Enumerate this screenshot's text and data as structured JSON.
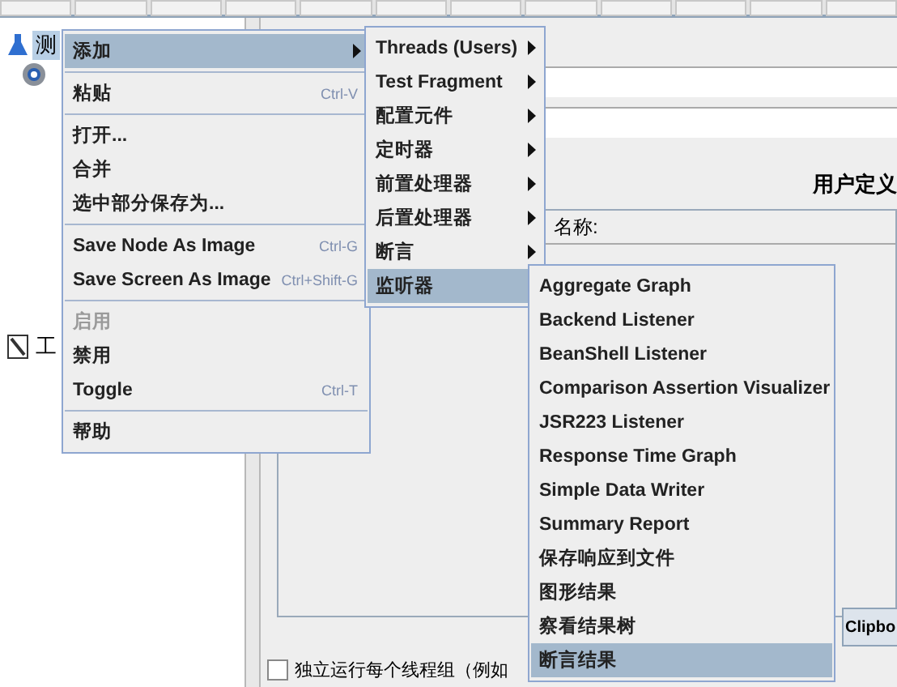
{
  "tree": {
    "items": [
      {
        "label": "测",
        "selected": true,
        "kind": "plan"
      },
      {
        "selected": false,
        "kind": "gear"
      },
      {
        "label": "工",
        "selected": false,
        "kind": "bench"
      }
    ]
  },
  "editor": {
    "table_title": "用户定义",
    "table_header": "名称:",
    "clipboard_button": "Clipbo",
    "checkbox": {
      "label": "独立运行每个线程组（例如",
      "checked": false
    }
  },
  "context_menu": {
    "items": [
      {
        "kind": "item",
        "label": "添加",
        "submenu": true,
        "selected": true,
        "disabled": false
      },
      {
        "kind": "separator"
      },
      {
        "kind": "item",
        "label": "粘贴",
        "shortcut": "Ctrl-V",
        "submenu": false,
        "selected": false,
        "disabled": false
      },
      {
        "kind": "separator"
      },
      {
        "kind": "item",
        "label": "打开...",
        "submenu": false,
        "selected": false,
        "disabled": false
      },
      {
        "kind": "item",
        "label": "合并",
        "submenu": false,
        "selected": false,
        "disabled": false
      },
      {
        "kind": "item",
        "label": "选中部分保存为...",
        "submenu": false,
        "selected": false,
        "disabled": false
      },
      {
        "kind": "separator"
      },
      {
        "kind": "item",
        "label": "Save Node As Image",
        "shortcut": "Ctrl-G",
        "submenu": false,
        "selected": false,
        "disabled": false
      },
      {
        "kind": "item",
        "label": "Save Screen As Image",
        "shortcut": "Ctrl+Shift-G",
        "submenu": false,
        "selected": false,
        "disabled": false
      },
      {
        "kind": "separator"
      },
      {
        "kind": "item",
        "label": "启用",
        "submenu": false,
        "selected": false,
        "disabled": true
      },
      {
        "kind": "item",
        "label": "禁用",
        "submenu": false,
        "selected": false,
        "disabled": false
      },
      {
        "kind": "item",
        "label": "Toggle",
        "shortcut": "Ctrl-T",
        "submenu": false,
        "selected": false,
        "disabled": false
      },
      {
        "kind": "separator"
      },
      {
        "kind": "item",
        "label": "帮助",
        "submenu": false,
        "selected": false,
        "disabled": false
      }
    ]
  },
  "add_submenu": {
    "items": [
      {
        "kind": "item",
        "label": "Threads (Users)",
        "submenu": true,
        "selected": false,
        "disabled": false
      },
      {
        "kind": "item",
        "label": "Test Fragment",
        "submenu": true,
        "selected": false,
        "disabled": false
      },
      {
        "kind": "item",
        "label": "配置元件",
        "submenu": true,
        "selected": false,
        "disabled": false
      },
      {
        "kind": "item",
        "label": "定时器",
        "submenu": true,
        "selected": false,
        "disabled": false
      },
      {
        "kind": "item",
        "label": "前置处理器",
        "submenu": true,
        "selected": false,
        "disabled": false
      },
      {
        "kind": "item",
        "label": "后置处理器",
        "submenu": true,
        "selected": false,
        "disabled": false
      },
      {
        "kind": "item",
        "label": "断言",
        "submenu": true,
        "selected": false,
        "disabled": false
      },
      {
        "kind": "item",
        "label": "监听器",
        "submenu": true,
        "selected": true,
        "disabled": false
      }
    ]
  },
  "listener_submenu": {
    "items": [
      {
        "kind": "item",
        "label": "Aggregate Graph",
        "submenu": false,
        "selected": false,
        "disabled": false
      },
      {
        "kind": "item",
        "label": "Backend Listener",
        "submenu": false,
        "selected": false,
        "disabled": false
      },
      {
        "kind": "item",
        "label": "BeanShell Listener",
        "submenu": false,
        "selected": false,
        "disabled": false
      },
      {
        "kind": "item",
        "label": "Comparison Assertion Visualizer",
        "submenu": false,
        "selected": false,
        "disabled": false
      },
      {
        "kind": "item",
        "label": "JSR223 Listener",
        "submenu": false,
        "selected": false,
        "disabled": false
      },
      {
        "kind": "item",
        "label": "Response Time Graph",
        "submenu": false,
        "selected": false,
        "disabled": false
      },
      {
        "kind": "item",
        "label": "Simple Data Writer",
        "submenu": false,
        "selected": false,
        "disabled": false
      },
      {
        "kind": "item",
        "label": "Summary Report",
        "submenu": false,
        "selected": false,
        "disabled": false
      },
      {
        "kind": "item",
        "label": "保存响应到文件",
        "submenu": false,
        "selected": false,
        "disabled": false
      },
      {
        "kind": "item",
        "label": "图形结果",
        "submenu": false,
        "selected": false,
        "disabled": false
      },
      {
        "kind": "item",
        "label": "察看结果树",
        "submenu": false,
        "selected": false,
        "disabled": false
      },
      {
        "kind": "item",
        "label": "断言结果",
        "submenu": false,
        "selected": true,
        "disabled": false
      }
    ]
  }
}
